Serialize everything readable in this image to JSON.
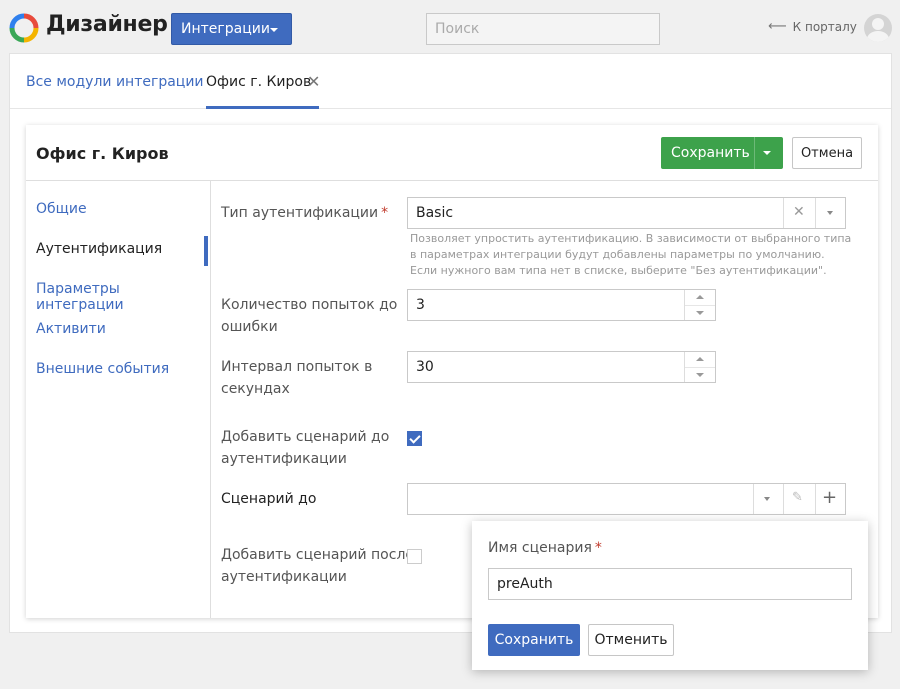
{
  "header": {
    "brand": "Дизайнер",
    "integrations_button": "Интеграции",
    "search_placeholder": "Поиск",
    "portal_link": "К порталу",
    "colors": {
      "accent": "#3f6bbf",
      "success": "#3da24b",
      "required": "#c0392b"
    }
  },
  "tabs": {
    "all_modules": "Все модули интеграции",
    "current": "Офис г. Киров"
  },
  "card": {
    "title": "Офис г. Киров",
    "save": "Сохранить",
    "cancel": "Отмена"
  },
  "sidebar": {
    "items": [
      {
        "label": "Общие",
        "active": false
      },
      {
        "label": "Аутентификация",
        "active": true
      },
      {
        "label": "Параметры интеграции",
        "active": false
      },
      {
        "label": "Активити",
        "active": false
      },
      {
        "label": "Внешние события",
        "active": false
      }
    ]
  },
  "form": {
    "auth_type": {
      "label": "Тип аутентификации",
      "value": "Basic",
      "hint_lines": [
        "Позволяет упростить аутентификацию. В зависимости от выбранного типа",
        "в параметрах интеграции будут добавлены параметры по умолчанию.",
        "Если нужного вам типа нет в списке, выберите \"Без аутентификации\"."
      ]
    },
    "attempts": {
      "label_lines": [
        "Количество попыток до",
        "ошибки"
      ],
      "value": "3"
    },
    "interval": {
      "label_lines": [
        "Интервал попыток в",
        "секундах"
      ],
      "value": "30"
    },
    "pre_script_toggle": {
      "label_lines": [
        "Добавить сценарий до",
        "аутентификации"
      ],
      "checked": true
    },
    "pre_script": {
      "label": "Сценарий до",
      "value": ""
    },
    "post_script_toggle": {
      "label_lines": [
        "Добавить сценарий после",
        "аутентификации"
      ],
      "checked": false
    }
  },
  "popup": {
    "label": "Имя сценария",
    "value": "preAuth",
    "save": "Сохранить",
    "cancel": "Отменить"
  },
  "icons": {
    "logo": "multicolor-ring-logo",
    "back": "arrow-left-icon",
    "close": "close-icon",
    "clear": "clear-icon",
    "edit": "pencil-icon",
    "add": "plus-icon"
  },
  "required_mark": "*"
}
